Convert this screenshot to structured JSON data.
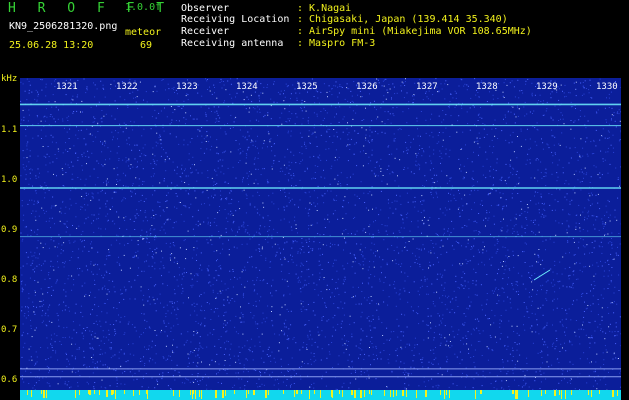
{
  "app": {
    "title": "H R O F F T",
    "version": "1.0.0f"
  },
  "file": {
    "name": "KN9_2506281320.png",
    "datetime": "25.06.28 13:20"
  },
  "meteor": {
    "label": "meteor",
    "count": "69"
  },
  "info": [
    {
      "key": "Observer",
      "value": ": K.Nagai"
    },
    {
      "key": "Receiving Location",
      "value": ": Chigasaki, Japan (139.414 35.340)"
    },
    {
      "key": "Receiver",
      "value": ": AirSpy mini (Miakejima VOR 108.65MHz)"
    },
    {
      "key": "Receiving antenna",
      "value": ": Maspro FM-3"
    }
  ],
  "chart_data": {
    "type": "heatmap",
    "xlabel": "",
    "ylabel": "kHz",
    "x_ticks": [
      "1321",
      "1322",
      "1323",
      "1324",
      "1325",
      "1326",
      "1327",
      "1328",
      "1329",
      "1330"
    ],
    "y_ticks": [
      "1.1",
      "1.0",
      "0.9",
      "0.8",
      "0.7",
      "0.6"
    ],
    "ylim": [
      0.58,
      1.17
    ],
    "horizontal_lines_khz": [
      1.12,
      1.08,
      0.962,
      0.87,
      0.62,
      0.605
    ],
    "colors": {
      "background": "#0b1e9a",
      "noise": "#4a64ff",
      "line": "#6ff0ff",
      "strip": "#11d8ee"
    }
  }
}
